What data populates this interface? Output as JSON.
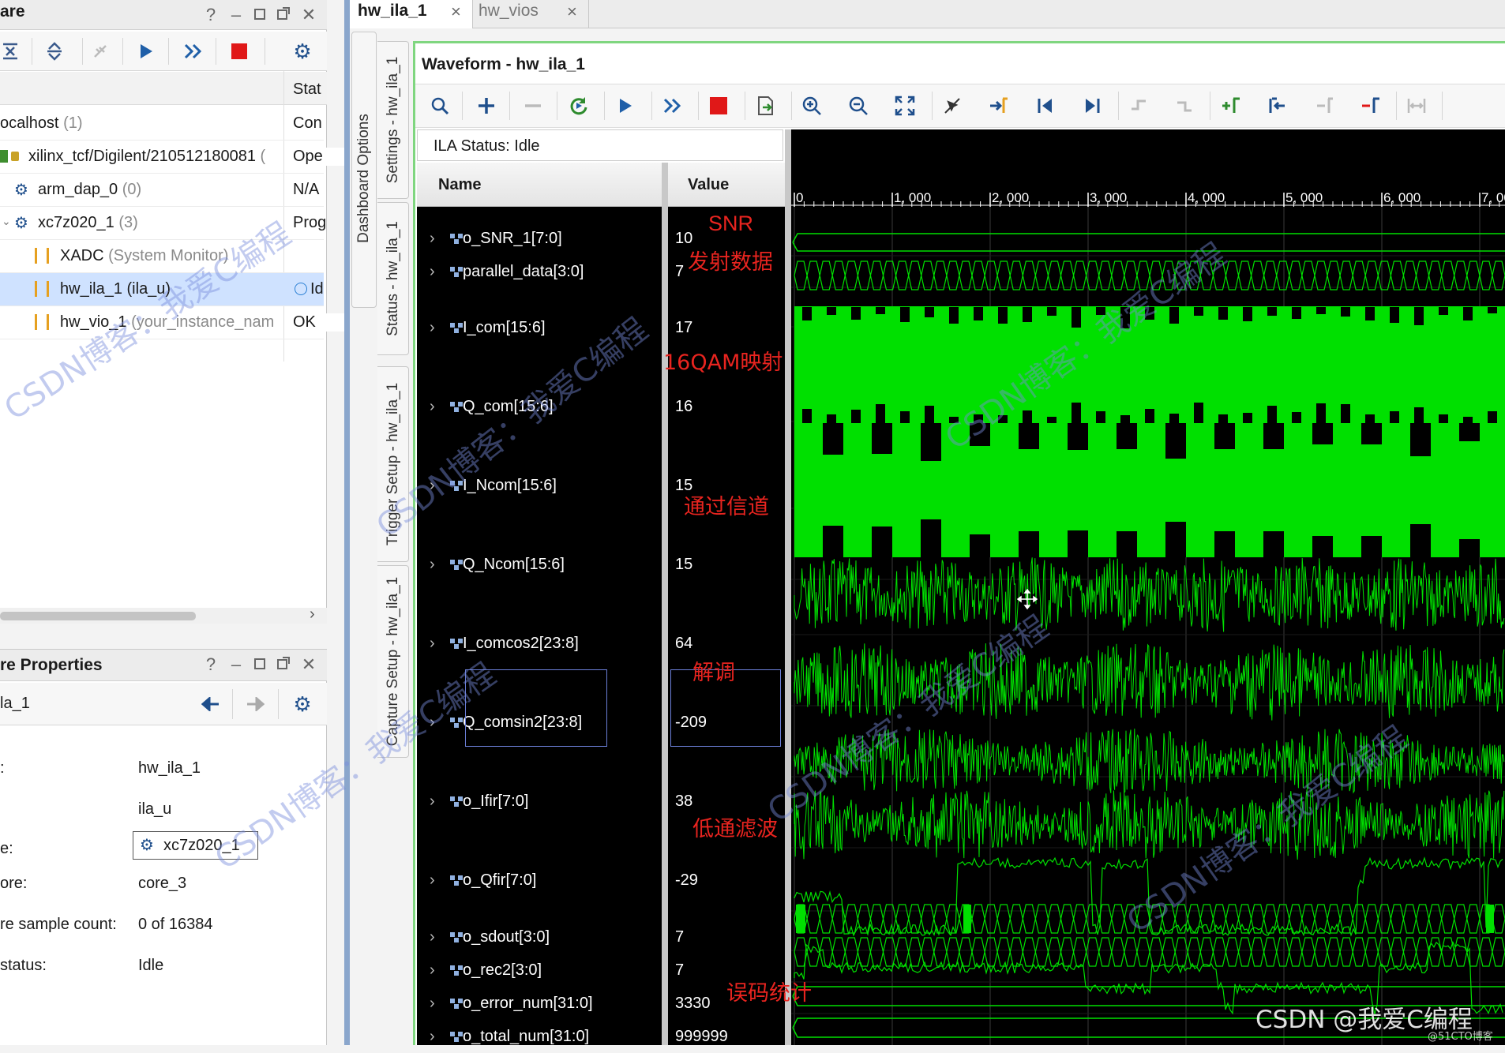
{
  "hardware_panel": {
    "title": "are",
    "status_col": "Stat",
    "rows": [
      {
        "name": "ocalhost",
        "sub": "(1)",
        "status": "Con"
      },
      {
        "name": "xilinx_tcf/Digilent/210512180081",
        "sub": "(",
        "status": "Ope"
      },
      {
        "name": "arm_dap_0",
        "sub": "(0)",
        "status": "N/A"
      },
      {
        "name": "xc7z020_1",
        "sub": "(3)",
        "status": "Prog"
      },
      {
        "name": "XADC",
        "sub": "(System Monitor)",
        "status": ""
      },
      {
        "name": "hw_ila_1",
        "sub": "(ila_u)",
        "status": "Id"
      },
      {
        "name": "hw_vio_1",
        "sub": "(your_instance_nam",
        "status": "OK"
      }
    ]
  },
  "props_panel": {
    "title": "re Properties",
    "object": "la_1",
    "rows": [
      {
        "label": ":",
        "value": "hw_ila_1"
      },
      {
        "label": "",
        "value": "ila_u"
      },
      {
        "label": "e:",
        "value": "xc7z020_1"
      },
      {
        "label": "ore:",
        "value": "core_3"
      },
      {
        "label": "re sample count:",
        "value": "0 of 16384"
      },
      {
        "label": "status:",
        "value": "Idle"
      }
    ]
  },
  "tabs": [
    {
      "label": "hw_ila_1",
      "close": "×"
    },
    {
      "label": "hw_vios",
      "close": "×"
    }
  ],
  "side_tabs": [
    "Dashboard Options",
    "Settings - hw_ila_1",
    "Status - hw_ila_1",
    "Trigger Setup - hw_ila_1",
    "Capture Setup - hw_ila_1"
  ],
  "waveform": {
    "title": "Waveform - hw_ila_1",
    "ila_status": "ILA Status:  Idle",
    "col_name": "Name",
    "col_value": "Value",
    "ticks": [
      "0",
      "1, 000",
      "2, 000",
      "3, 000",
      "4, 000",
      "5, 000",
      "6, 000",
      "7, 00"
    ],
    "signals": [
      {
        "name": "o_SNR_1[7:0]",
        "value": "10"
      },
      {
        "name": "parallel_data[3:0]",
        "value": "7"
      },
      {
        "name": "I_com[15:6]",
        "value": "17"
      },
      {
        "name": "Q_com[15:6]",
        "value": "16"
      },
      {
        "name": "I_Ncom[15:6]",
        "value": "15"
      },
      {
        "name": "Q_Ncom[15:6]",
        "value": "15"
      },
      {
        "name": "I_comcos2[23:8]",
        "value": "64"
      },
      {
        "name": "Q_comsin2[23:8]",
        "value": "-209"
      },
      {
        "name": "o_Ifir[7:0]",
        "value": "38"
      },
      {
        "name": "o_Qfir[7:0]",
        "value": "-29"
      },
      {
        "name": "o_sdout[3:0]",
        "value": "7"
      },
      {
        "name": "o_rec2[3:0]",
        "value": "7"
      },
      {
        "name": "o_error_num[31:0]",
        "value": "3330"
      },
      {
        "name": "o_total_num[31:0]",
        "value": "999999"
      }
    ]
  },
  "annotations": {
    "snr": "SNR",
    "tx": "发射数据",
    "qam": "16QAM映射",
    "channel": "通过信道",
    "demod": "解调",
    "lpf": "低通滤波",
    "ber": "误码统计"
  },
  "watermarks": {
    "blog": "CSDN博客：我爱C编程",
    "footer": "CSDN @我爱C编程",
    "footer2": "@51CTO博客"
  },
  "colors": {
    "wave": "#00e000",
    "wave_bg": "#000000",
    "annotation": "#e8241f",
    "selection": "#cfe2ff"
  }
}
